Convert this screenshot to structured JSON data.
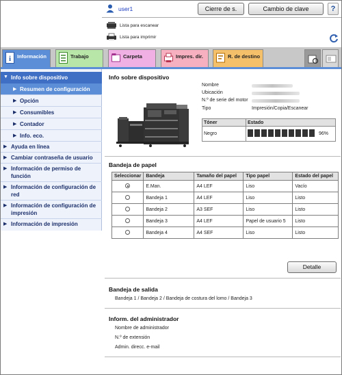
{
  "header": {
    "user_name": "user1",
    "logout_label": "Cierre de s.",
    "change_password_label": "Cambio de clave",
    "help_label": "?",
    "scan_list_label": "Lista para escanear",
    "print_list_label": "Lista para imprimir"
  },
  "tabs": [
    {
      "label": "Información",
      "icon": "info-icon"
    },
    {
      "label": "Trabajo",
      "icon": "job-icon"
    },
    {
      "label": "Carpeta",
      "icon": "box-icon"
    },
    {
      "label": "Impres. dir.",
      "icon": "direct-print-icon"
    },
    {
      "label": "R. de destino",
      "icon": "address-book-icon"
    }
  ],
  "sidebar": {
    "head": "Info sobre dispositivo",
    "subitems": [
      "Resumen de configuración",
      "Opción",
      "Consumibles",
      "Contador",
      "Info. eco."
    ],
    "items": [
      "Ayuda en línea",
      "Cambiar contraseña de usuario",
      "Información de permiso de función",
      "Información de configuración de red",
      "Información de configuración de impresión",
      "Información de impresión"
    ]
  },
  "device_info": {
    "title": "Info sobre dispositivo",
    "labels": [
      "Nombre",
      "Ubicación",
      "N.º de serie del motor",
      "Tipo"
    ],
    "type_value": "Impresión/Copia/Escanear",
    "toner_header": "Tóner",
    "status_header": "Estado",
    "toner_name": "Negro",
    "toner_percent": "96%",
    "toner_level": 0.96
  },
  "paper_tray": {
    "title": "Bandeja de papel",
    "headers": [
      "Seleccionar",
      "Bandeja",
      "Tamaño del papel",
      "Tipo papel",
      "Estado del papel"
    ],
    "rows": [
      {
        "tray": "E.Man.",
        "size": "A4 LEF",
        "type": "Liso",
        "status": "Vacío",
        "selected": true
      },
      {
        "tray": "Bandeja 1",
        "size": "A4 LEF",
        "type": "Liso",
        "status": "Listo",
        "selected": false
      },
      {
        "tray": "Bandeja 2",
        "size": "A3 SEF",
        "type": "Liso",
        "status": "Listo",
        "selected": false
      },
      {
        "tray": "Bandeja 3",
        "size": "A4 LEF",
        "type": "Papel de usuario 5",
        "status": "Listo",
        "selected": false
      },
      {
        "tray": "Bandeja 4",
        "size": "A4 SEF",
        "type": "Liso",
        "status": "Listo",
        "selected": false
      }
    ],
    "detail_label": "Detalle"
  },
  "output_tray": {
    "title": "Bandeja de salida",
    "value": "Bandeja 1 / Bandeja 2 / Bandeja de costura del lomo / Bandeja 3"
  },
  "admin_info": {
    "title": "Inform. del administrador",
    "labels": [
      "Nombre de administrador",
      "N.º de extensión",
      "Admin. direcc. e-mail"
    ]
  },
  "colors": {
    "accent_blue": "#5b8ed6",
    "sidebar_head": "#3f6fc4",
    "tab_job": "#b8e6a8",
    "tab_box": "#f0b0e3",
    "tab_print": "#f6b0bf",
    "tab_dest": "#f5c06a"
  }
}
